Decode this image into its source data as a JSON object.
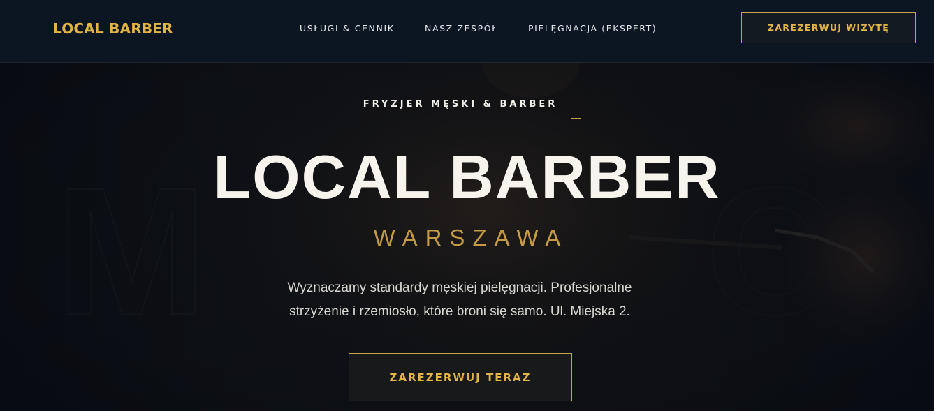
{
  "header": {
    "logo": "LOCAL BARBER",
    "nav": [
      {
        "label": "USŁUGI & CENNIK"
      },
      {
        "label": "NASZ ZESPÓŁ"
      },
      {
        "label": "PIELĘGNACJA (EKSPERT)"
      }
    ],
    "cta": "ZAREZERWUJ WIZYTĘ"
  },
  "hero": {
    "tagline": "FRYZJER MĘSKI & BARBER",
    "title": "LOCAL BARBER",
    "city": "WARSZAWA",
    "description": "Wyznaczamy standardy męskiej pielęgnacji. Profesjonalne strzyżenie i rzemiosło, które broni się samo. Ul. Miejska 2.",
    "cta": "ZAREZERWUJ TERAZ"
  },
  "colors": {
    "gold": "#e2b445",
    "gold_muted": "#c49a45",
    "navbar_bg": "#0c1623",
    "hero_bg": "#0b1019",
    "text_light": "#f7f4ee"
  }
}
